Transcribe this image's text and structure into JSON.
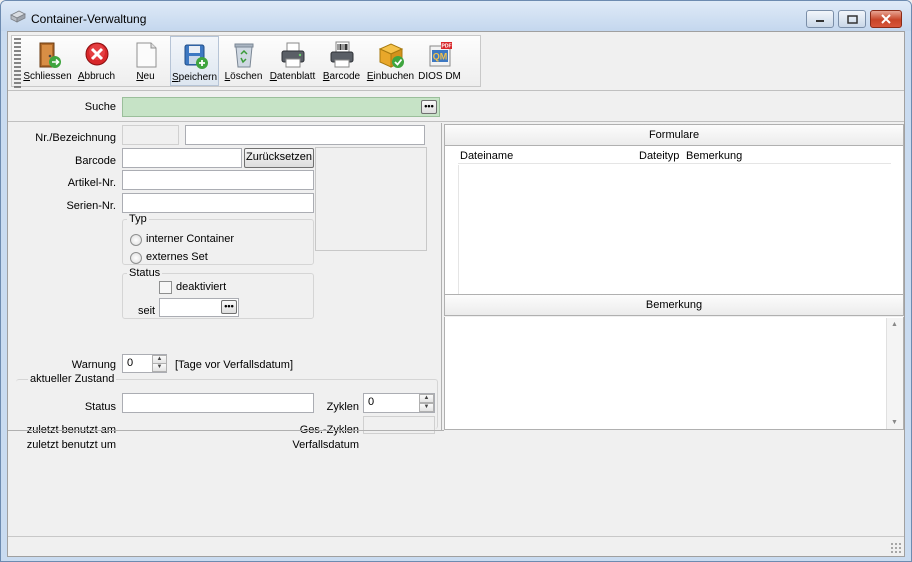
{
  "window": {
    "title": "Container-Verwaltung"
  },
  "toolbar": {
    "items": [
      {
        "label": "Schliessen",
        "key": "S",
        "icon": "door-exit-icon"
      },
      {
        "label": "Abbruch",
        "key": "A",
        "icon": "cancel-icon"
      },
      {
        "label": "Neu",
        "key": "N",
        "icon": "new-document-icon"
      },
      {
        "label": "Speichern",
        "key": "S",
        "icon": "save-icon"
      },
      {
        "label": "Löschen",
        "key": "L",
        "icon": "recycle-bin-icon"
      },
      {
        "label": "Datenblatt",
        "key": "D",
        "icon": "printer-icon"
      },
      {
        "label": "Barcode",
        "key": "B",
        "icon": "barcode-printer-icon"
      },
      {
        "label": "Einbuchen",
        "key": "E",
        "icon": "box-check-icon"
      },
      {
        "label": "DIOS DM",
        "key": "",
        "icon": "dios-dm-icon"
      }
    ]
  },
  "search": {
    "label": "Suche",
    "value": ""
  },
  "form": {
    "nr_label": "Nr./Bezeichnung",
    "nr_value": "",
    "bezeichnung_value": "",
    "barcode_label": "Barcode",
    "barcode_value": "",
    "reset_button": "Zurücksetzen",
    "artikel_label": "Artikel-Nr.",
    "artikel_value": "",
    "serien_label": "Serien-Nr.",
    "serien_value": "",
    "typ": {
      "title": "Typ",
      "options": [
        "interner Container",
        "externes Set"
      ]
    },
    "status_group": {
      "title": "Status",
      "deaktiviert_label": "deaktiviert",
      "seit_label": "seit",
      "seit_value": ""
    },
    "warnung_label": "Warnung",
    "warnung_value": "0",
    "warnung_hint": "[Tage vor Verfallsdatum]"
  },
  "zustand": {
    "title": "aktueller Zustand",
    "status_label": "Status",
    "status_value": "",
    "zyklen_label": "Zyklen",
    "zyklen_value": "0",
    "zuletzt_am_label": "zuletzt benutzt am",
    "zuletzt_um_label": "zuletzt benutzt um",
    "ges_zyklen_label": "Ges.-Zyklen",
    "verfallsdatum_label": "Verfallsdatum"
  },
  "formulare": {
    "title": "Formulare",
    "columns": [
      "Dateiname",
      "Dateityp",
      "Bemerkung"
    ]
  },
  "bemerkung": {
    "title": "Bemerkung",
    "value": ""
  }
}
